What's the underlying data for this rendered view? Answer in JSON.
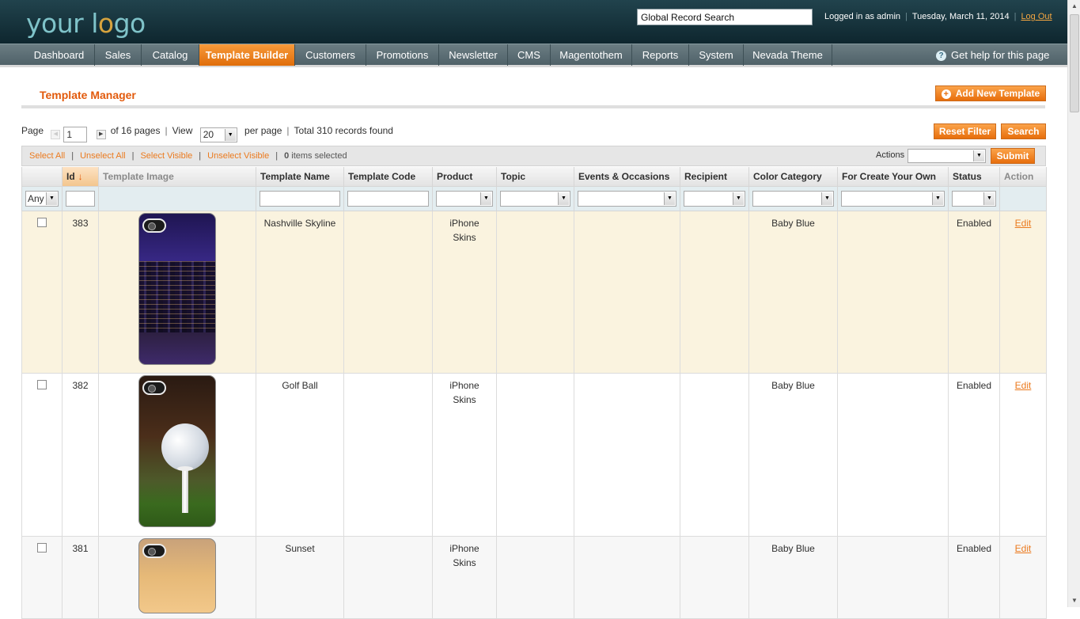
{
  "header": {
    "logo_part1": "your l",
    "logo_part2": "o",
    "logo_part3": "go",
    "search_value": "Global Record Search",
    "logged_in": "Logged in as admin",
    "date": "Tuesday, March 11, 2014",
    "logout": "Log Out"
  },
  "nav": {
    "items": [
      "Dashboard",
      "Sales",
      "Catalog",
      "Template Builder",
      "Customers",
      "Promotions",
      "Newsletter",
      "CMS",
      "Magentothem",
      "Reports",
      "System",
      "Nevada Theme"
    ],
    "active": "Template Builder",
    "help": "Get help for this page"
  },
  "page": {
    "title": "Template Manager",
    "add_button": "Add New Template",
    "reset_button": "Reset Filter",
    "search_button": "Search"
  },
  "pager": {
    "page_label": "Page",
    "page_value": "1",
    "of_pages": "of 16 pages",
    "view_label": "View",
    "per_page_value": "20",
    "per_page_label": "per page",
    "total": "Total 310 records found"
  },
  "massaction": {
    "select_all": "Select All",
    "unselect_all": "Unselect All",
    "select_visible": "Select Visible",
    "unselect_visible": "Unselect Visible",
    "selected_count": "0",
    "selected_text": "items selected",
    "actions_label": "Actions",
    "submit": "Submit"
  },
  "grid": {
    "columns": [
      "Id",
      "Template Image",
      "Template Name",
      "Template Code",
      "Product",
      "Topic",
      "Events & Occasions",
      "Recipient",
      "Color Category",
      "For Create Your Own",
      "Status",
      "Action"
    ],
    "sort_arrow": "↓",
    "any_option": "Any",
    "rows": [
      {
        "id": "383",
        "image": "nashville-skyline-phone",
        "name": "Nashville Skyline",
        "code": "",
        "product_l1": "iPhone",
        "product_l2": "Skins",
        "topic": "",
        "events": "",
        "recipient": "",
        "color": "Baby Blue",
        "create_own": "",
        "status": "Enabled",
        "action": "Edit"
      },
      {
        "id": "382",
        "image": "golf-ball-phone",
        "name": "Golf Ball",
        "code": "",
        "product_l1": "iPhone",
        "product_l2": "Skins",
        "topic": "",
        "events": "",
        "recipient": "",
        "color": "Baby Blue",
        "create_own": "",
        "status": "Enabled",
        "action": "Edit"
      },
      {
        "id": "381",
        "image": "sunset-phone",
        "name": "Sunset",
        "code": "",
        "product_l1": "iPhone",
        "product_l2": "Skins",
        "topic": "",
        "events": "",
        "recipient": "",
        "color": "Baby Blue",
        "create_own": "",
        "status": "Enabled",
        "action": "Edit"
      }
    ]
  },
  "colors": {
    "accent": "#eb7a1e",
    "header_bg": "#0f2a33",
    "nav_bg": "#55676d",
    "active_row": "#faf3df"
  }
}
